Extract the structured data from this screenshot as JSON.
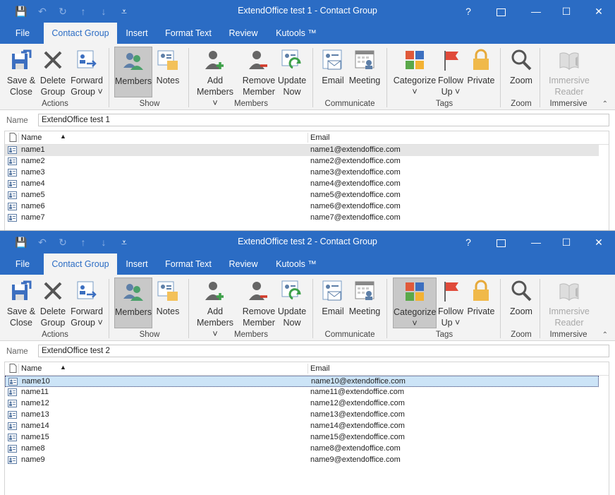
{
  "windows": [
    {
      "title": "ExtendOffice test 1  -  Contact Group",
      "name_label": "Name",
      "name_value": "ExtendOffice test 1",
      "selected_category": false,
      "rows": [
        {
          "name": "name1",
          "email": "name1@extendoffice.com"
        },
        {
          "name": "name2",
          "email": "name2@extendoffice.com"
        },
        {
          "name": "name3",
          "email": "name3@extendoffice.com"
        },
        {
          "name": "name4",
          "email": "name4@extendoffice.com"
        },
        {
          "name": "name5",
          "email": "name5@extendoffice.com"
        },
        {
          "name": "name6",
          "email": "name6@extendoffice.com"
        },
        {
          "name": "name7",
          "email": "name7@extendoffice.com"
        }
      ]
    },
    {
      "title": "ExtendOffice test 2  -  Contact Group",
      "name_label": "Name",
      "name_value": "ExtendOffice test 2",
      "selected_category": true,
      "rows": [
        {
          "name": "name10",
          "email": "name10@extendoffice.com"
        },
        {
          "name": "name11",
          "email": "name11@extendoffice.com"
        },
        {
          "name": "name12",
          "email": "name12@extendoffice.com"
        },
        {
          "name": "name13",
          "email": "name13@extendoffice.com"
        },
        {
          "name": "name14",
          "email": "name14@extendoffice.com"
        },
        {
          "name": "name15",
          "email": "name15@extendoffice.com"
        },
        {
          "name": "name8",
          "email": "name8@extendoffice.com"
        },
        {
          "name": "name9",
          "email": "name9@extendoffice.com"
        }
      ]
    }
  ],
  "tabs": [
    "File",
    "Contact Group",
    "Insert",
    "Format Text",
    "Review",
    "Kutools ™"
  ],
  "window_buttons": {
    "help": "?",
    "minimize": "—",
    "maximize": "☐",
    "close": "✕"
  },
  "ribbon": {
    "save_close": [
      "Save &",
      "Close"
    ],
    "delete_group": [
      "Delete",
      "Group"
    ],
    "forward_group": [
      "Forward",
      "Group ˅"
    ],
    "members": "Members",
    "notes": "Notes",
    "add_members": [
      "Add",
      "Members ˅"
    ],
    "remove_member": [
      "Remove",
      "Member"
    ],
    "update_now": [
      "Update",
      "Now"
    ],
    "email": "Email",
    "meeting": "Meeting",
    "categorize": [
      "Categorize",
      "˅"
    ],
    "follow_up": [
      "Follow",
      "Up ˅"
    ],
    "private": "Private",
    "zoom": "Zoom",
    "immersive_reader": [
      "Immersive",
      "Reader"
    ],
    "groups": {
      "actions": "Actions",
      "show": "Show",
      "members": "Members",
      "communicate": "Communicate",
      "tags": "Tags",
      "zoom": "Zoom",
      "immersive": "Immersive"
    }
  },
  "columns": {
    "name": "Name",
    "email": "Email"
  },
  "colors": {
    "accent": "#2b6cc4",
    "ribbon_bg": "#f3f3f3",
    "selected_row": "#cce4f7"
  }
}
